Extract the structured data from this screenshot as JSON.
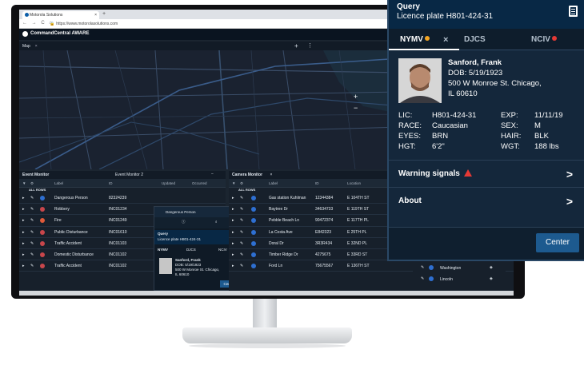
{
  "browser": {
    "tab_title": "Motorola Solutions",
    "url": "https://www.motorolasolutions.com"
  },
  "app": {
    "title": "CommandCentral AWARE"
  },
  "map_panel": {
    "title": "Map"
  },
  "event_monitor": {
    "title": "Event Monitor",
    "tab2": "Event Monitor 2",
    "columns": [
      "Label",
      "ID",
      "Updated",
      "Occurred"
    ],
    "all_rows": "ALL ROWS",
    "rows": [
      {
        "label": "Dangerous Person",
        "id": "82324239"
      },
      {
        "label": "Robbery",
        "id": "INC01234"
      },
      {
        "label": "Fire",
        "id": "INC01249"
      },
      {
        "label": "Public Disturbance",
        "id": "INC01610"
      },
      {
        "label": "Traffic Accident",
        "id": "INC01103"
      },
      {
        "label": "Domestic Disturbance",
        "id": "INC01102"
      },
      {
        "label": "Traffic Accident",
        "id": "INC01102"
      }
    ]
  },
  "mini_popup": {
    "title": "Dangerous Person",
    "query": "Query",
    "plate": "Licence plate H801-424-31",
    "tabs": [
      "NYMV",
      "DJCS",
      "NCIV"
    ],
    "name": "Sanford, Frank",
    "dob": "DOB: 5/19/1923",
    "addr1": "500 W Monroe St. Chicago,",
    "addr2": "IL 60610",
    "center": "Center"
  },
  "camera_monitor": {
    "title": "Camera Monitor",
    "columns": [
      "Label",
      "ID",
      "Location"
    ],
    "all_rows": "ALL ROWS",
    "rows": [
      {
        "label": "Gas station Kuhlman",
        "id": "12344384",
        "loc": "E 104TH ST"
      },
      {
        "label": "Baytree Dr",
        "id": "34634733",
        "loc": "E 119TH ST"
      },
      {
        "label": "Pebble Beach Ln",
        "id": "90472374",
        "loc": "E 117TH PL"
      },
      {
        "label": "La Costa Ave",
        "id": "E842323",
        "loc": "E 25TH PL"
      },
      {
        "label": "Doral Dr",
        "id": "3R3R434",
        "loc": "E 32ND PL"
      },
      {
        "label": "Timber Ridge Dr",
        "id": "4275675",
        "loc": "E 33RD ST"
      },
      {
        "label": "Ford Ln",
        "id": "75675567",
        "loc": "E 136TH ST"
      }
    ],
    "under_rows": [
      "Washington",
      "Lincoln"
    ]
  },
  "card": {
    "title": "Query",
    "subtitle": "Licence plate H801-424-31",
    "tabs": [
      {
        "label": "NYMV",
        "dot": "#f5a623"
      },
      {
        "label": "DJCS"
      },
      {
        "label": "NCIV",
        "dot": "#e53935"
      }
    ],
    "person": {
      "name": "Sanford, Frank",
      "dob": "DOB: 5/19/1923",
      "addr1": "500 W Monroe St. Chicago,",
      "addr2": "IL 60610"
    },
    "fields": {
      "lic_label": "LIC:",
      "lic": "H801-424-31",
      "exp_label": "EXP:",
      "exp": "11/11/19",
      "race_label": "RACE:",
      "race": "Caucasian",
      "sex_label": "SEX:",
      "sex": "M",
      "eyes_label": "EYES:",
      "eyes": "BRN",
      "hair_label": "HAIR:",
      "hair": "BLK",
      "hgt_label": "HGT:",
      "hgt": "6'2\"",
      "wgt_label": "WGT:",
      "wgt": "188 lbs"
    },
    "warning_label": "Warning signals",
    "about_label": "About",
    "center_label": "Center"
  },
  "colors": {
    "accent": "#1d5a8f",
    "warning": "#e53935",
    "status_dot": "#f5a623",
    "map_bg": "#1a2230"
  }
}
